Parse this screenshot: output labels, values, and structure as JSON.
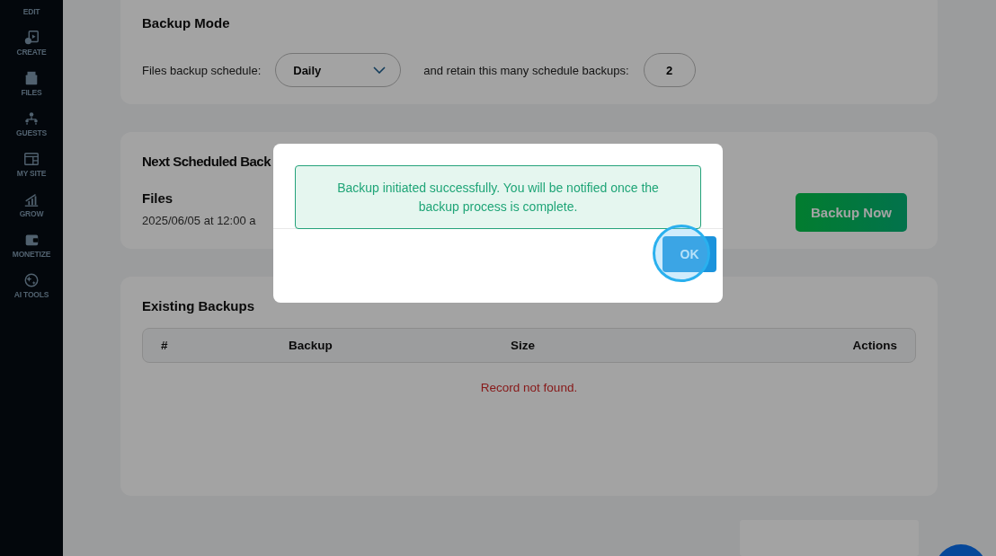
{
  "sidebar": {
    "items": [
      {
        "label": "EDIT",
        "selected": false
      },
      {
        "label": "CREATE",
        "selected": false
      },
      {
        "label": "FILES",
        "selected": false
      },
      {
        "label": "GUESTS",
        "selected": false
      },
      {
        "label": "MY SITE",
        "selected": false
      },
      {
        "label": "GROW",
        "selected": false
      },
      {
        "label": "MONETIZE",
        "selected": false
      },
      {
        "label": "AI TOOLS",
        "selected": false
      }
    ]
  },
  "backup_mode": {
    "title": "Backup Mode",
    "schedule_label": "Files backup schedule:",
    "schedule_value": "Daily",
    "retain_label": "and retain this many schedule backups:",
    "retain_value": "2"
  },
  "next_scheduled": {
    "title": "Next Scheduled Back",
    "files_label": "Files",
    "date": "2025/06/05 at 12:00 a",
    "button": "Backup Now"
  },
  "existing_backups": {
    "title": "Existing Backups",
    "columns": [
      "#",
      "Backup",
      "Size",
      "Actions"
    ],
    "empty_message": "Record not found."
  },
  "dialog": {
    "message": "Backup initiated successfully. You will be notified once the backup process is complete.",
    "ok_button": "OK"
  }
}
